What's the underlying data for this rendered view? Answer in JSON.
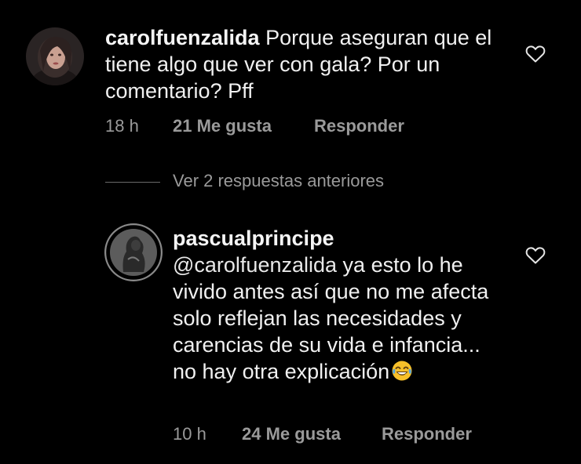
{
  "comments": [
    {
      "username": "carolfuenzalida",
      "text": "Porque aseguran que el tiene algo que ver con gala? Por un comentario? Pff",
      "time": "18 h",
      "likes": "21 Me gusta",
      "reply_label": "Responder",
      "icon": "heart-outline-icon"
    },
    {
      "username": "pascualprincipe",
      "mention": "@carolfuenzalida",
      "text": "ya esto lo he vivido antes así que no me afecta solo reflejan las necesidades y carencias de su vida e infancia... no hay otra explicación",
      "emoji": "😂",
      "time": "10 h",
      "likes": "24 Me gusta",
      "reply_label": "Responder",
      "icon": "heart-outline-icon"
    }
  ],
  "view_replies": {
    "label": "Ver 2 respuestas anteriores"
  },
  "colors": {
    "background": "#000000",
    "text": "#f0f0f0",
    "secondary": "#9a9a9a",
    "story_ring": "#8a8a8a"
  }
}
